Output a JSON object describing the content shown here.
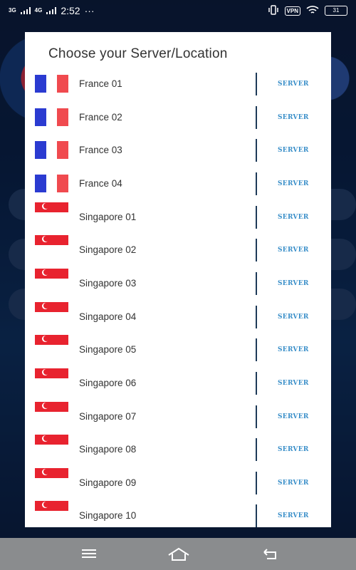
{
  "status_bar": {
    "network_left": "3G",
    "network_right": "4G",
    "time": "2:52",
    "more": "···",
    "vpn": "VPN",
    "battery": "31"
  },
  "dialog": {
    "title": "Choose your Server/Location",
    "server_label": "SERVER",
    "rows": [
      {
        "name": "France 01",
        "flag": "france-flag"
      },
      {
        "name": "France 02",
        "flag": "france-flag"
      },
      {
        "name": "France 03",
        "flag": "france-flag"
      },
      {
        "name": "France 04",
        "flag": "france-flag"
      },
      {
        "name": "Singapore 01",
        "flag": "singapore-flag"
      },
      {
        "name": "Singapore 02",
        "flag": "singapore-flag"
      },
      {
        "name": "Singapore 03",
        "flag": "singapore-flag"
      },
      {
        "name": "Singapore 04",
        "flag": "singapore-flag"
      },
      {
        "name": "Singapore 05",
        "flag": "singapore-flag"
      },
      {
        "name": "Singapore 06",
        "flag": "singapore-flag"
      },
      {
        "name": "Singapore 07",
        "flag": "singapore-flag"
      },
      {
        "name": "Singapore 08",
        "flag": "singapore-flag"
      },
      {
        "name": "Singapore 09",
        "flag": "singapore-flag"
      },
      {
        "name": "Singapore 10",
        "flag": "singapore-flag"
      }
    ]
  },
  "colors": {
    "server_text": "#3a8fc9",
    "divider": "#1d3a58",
    "france_blue": "#2b3bd1",
    "france_red": "#f04a4f",
    "singapore_red": "#e8232f",
    "navbar": "#8a8c8e"
  },
  "nav_bar": {
    "icons": [
      "menu-icon",
      "home-icon",
      "back-icon"
    ]
  }
}
